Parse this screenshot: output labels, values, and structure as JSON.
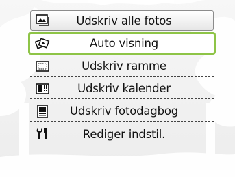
{
  "menu": {
    "items": [
      {
        "label": "Udskriv alle fotos",
        "icon": "print-all-photos-icon"
      },
      {
        "label": "Auto visning",
        "icon": "slideshow-icon",
        "selected": true
      },
      {
        "label": "Udskriv ramme",
        "icon": "frame-icon"
      },
      {
        "label": "Udskriv kalender",
        "icon": "calendar-icon"
      },
      {
        "label": "Udskriv fotodagbog",
        "icon": "photo-diary-icon"
      },
      {
        "label": "Rediger indstil.",
        "icon": "settings-tools-icon"
      }
    ]
  },
  "colors": {
    "selection_border": "#8ec447",
    "background": "#eeeeee",
    "silhouette": "#ffffff"
  }
}
